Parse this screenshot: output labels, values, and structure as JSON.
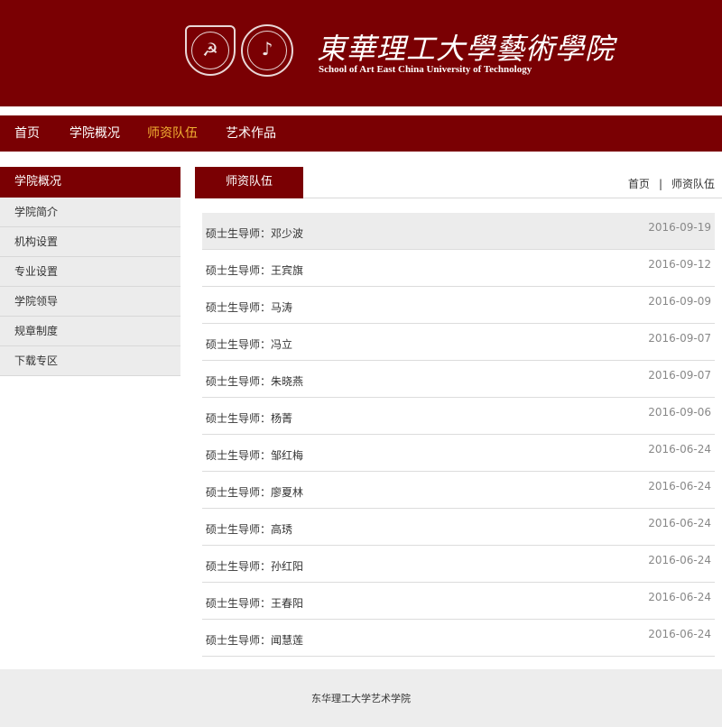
{
  "header": {
    "school_name_cn": "東華理工大學藝術學院",
    "school_name_en": "School of Art East China University of Technology"
  },
  "nav": {
    "items": [
      {
        "label": "首页"
      },
      {
        "label": "学院概况"
      },
      {
        "label": "师资队伍"
      },
      {
        "label": "艺术作品"
      }
    ],
    "active_color": "#f3b233"
  },
  "sidebar": {
    "title": "学院概况",
    "items": [
      {
        "label": "学院简介"
      },
      {
        "label": "机构设置"
      },
      {
        "label": "专业设置"
      },
      {
        "label": "学院领导"
      },
      {
        "label": "规章制度"
      },
      {
        "label": "下载专区"
      }
    ]
  },
  "main": {
    "title": "师资队伍",
    "breadcrumb": {
      "home": "首页",
      "separator": "|",
      "current": "师资队伍"
    },
    "rows": [
      {
        "title": "硕士生导师：邓少波",
        "date": "2016-09-19"
      },
      {
        "title": "硕士生导师：王宾旗",
        "date": "2016-09-12"
      },
      {
        "title": "硕士生导师：马涛",
        "date": "2016-09-09"
      },
      {
        "title": "硕士生导师：冯立",
        "date": "2016-09-07"
      },
      {
        "title": "硕士生导师：朱晓燕",
        "date": "2016-09-07"
      },
      {
        "title": "硕士生导师：杨菁",
        "date": "2016-09-06"
      },
      {
        "title": "硕士生导师：邹红梅",
        "date": "2016-06-24"
      },
      {
        "title": "硕士生导师：廖夏林",
        "date": "2016-06-24"
      },
      {
        "title": "硕士生导师：高琇",
        "date": "2016-06-24"
      },
      {
        "title": "硕士生导师：孙红阳",
        "date": "2016-06-24"
      },
      {
        "title": "硕士生导师：王春阳",
        "date": "2016-06-24"
      },
      {
        "title": "硕士生导师：闻慧莲",
        "date": "2016-06-24"
      }
    ]
  },
  "footer": {
    "text": "东华理工大学艺术学院"
  },
  "colors": {
    "brand": "#7a0003",
    "panel": "#ececec"
  },
  "icons": {
    "university_emblem": "university-emblem-icon",
    "college_emblem": "college-emblem-icon"
  }
}
